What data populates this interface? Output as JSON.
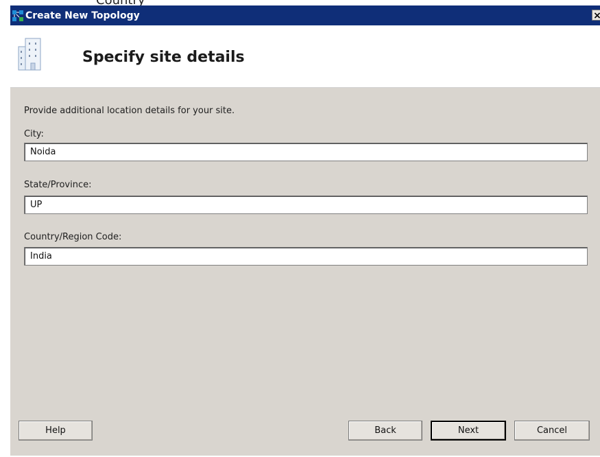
{
  "background_text": "Country",
  "window": {
    "title": "Create New Topology",
    "close_glyph": "×"
  },
  "header": {
    "title": "Specify site details",
    "icon": "building-icon"
  },
  "form": {
    "intro": "Provide additional location details for your site.",
    "city": {
      "label": "City:",
      "value": "Noida"
    },
    "state": {
      "label": "State/Province:",
      "value": "UP"
    },
    "country": {
      "label": "Country/Region Code:",
      "value": "India"
    }
  },
  "buttons": {
    "help": "Help",
    "back": "Back",
    "next": "Next",
    "cancel": "Cancel"
  },
  "colors": {
    "titlebar": "#0f2e78",
    "panel": "#d9d5cf"
  }
}
